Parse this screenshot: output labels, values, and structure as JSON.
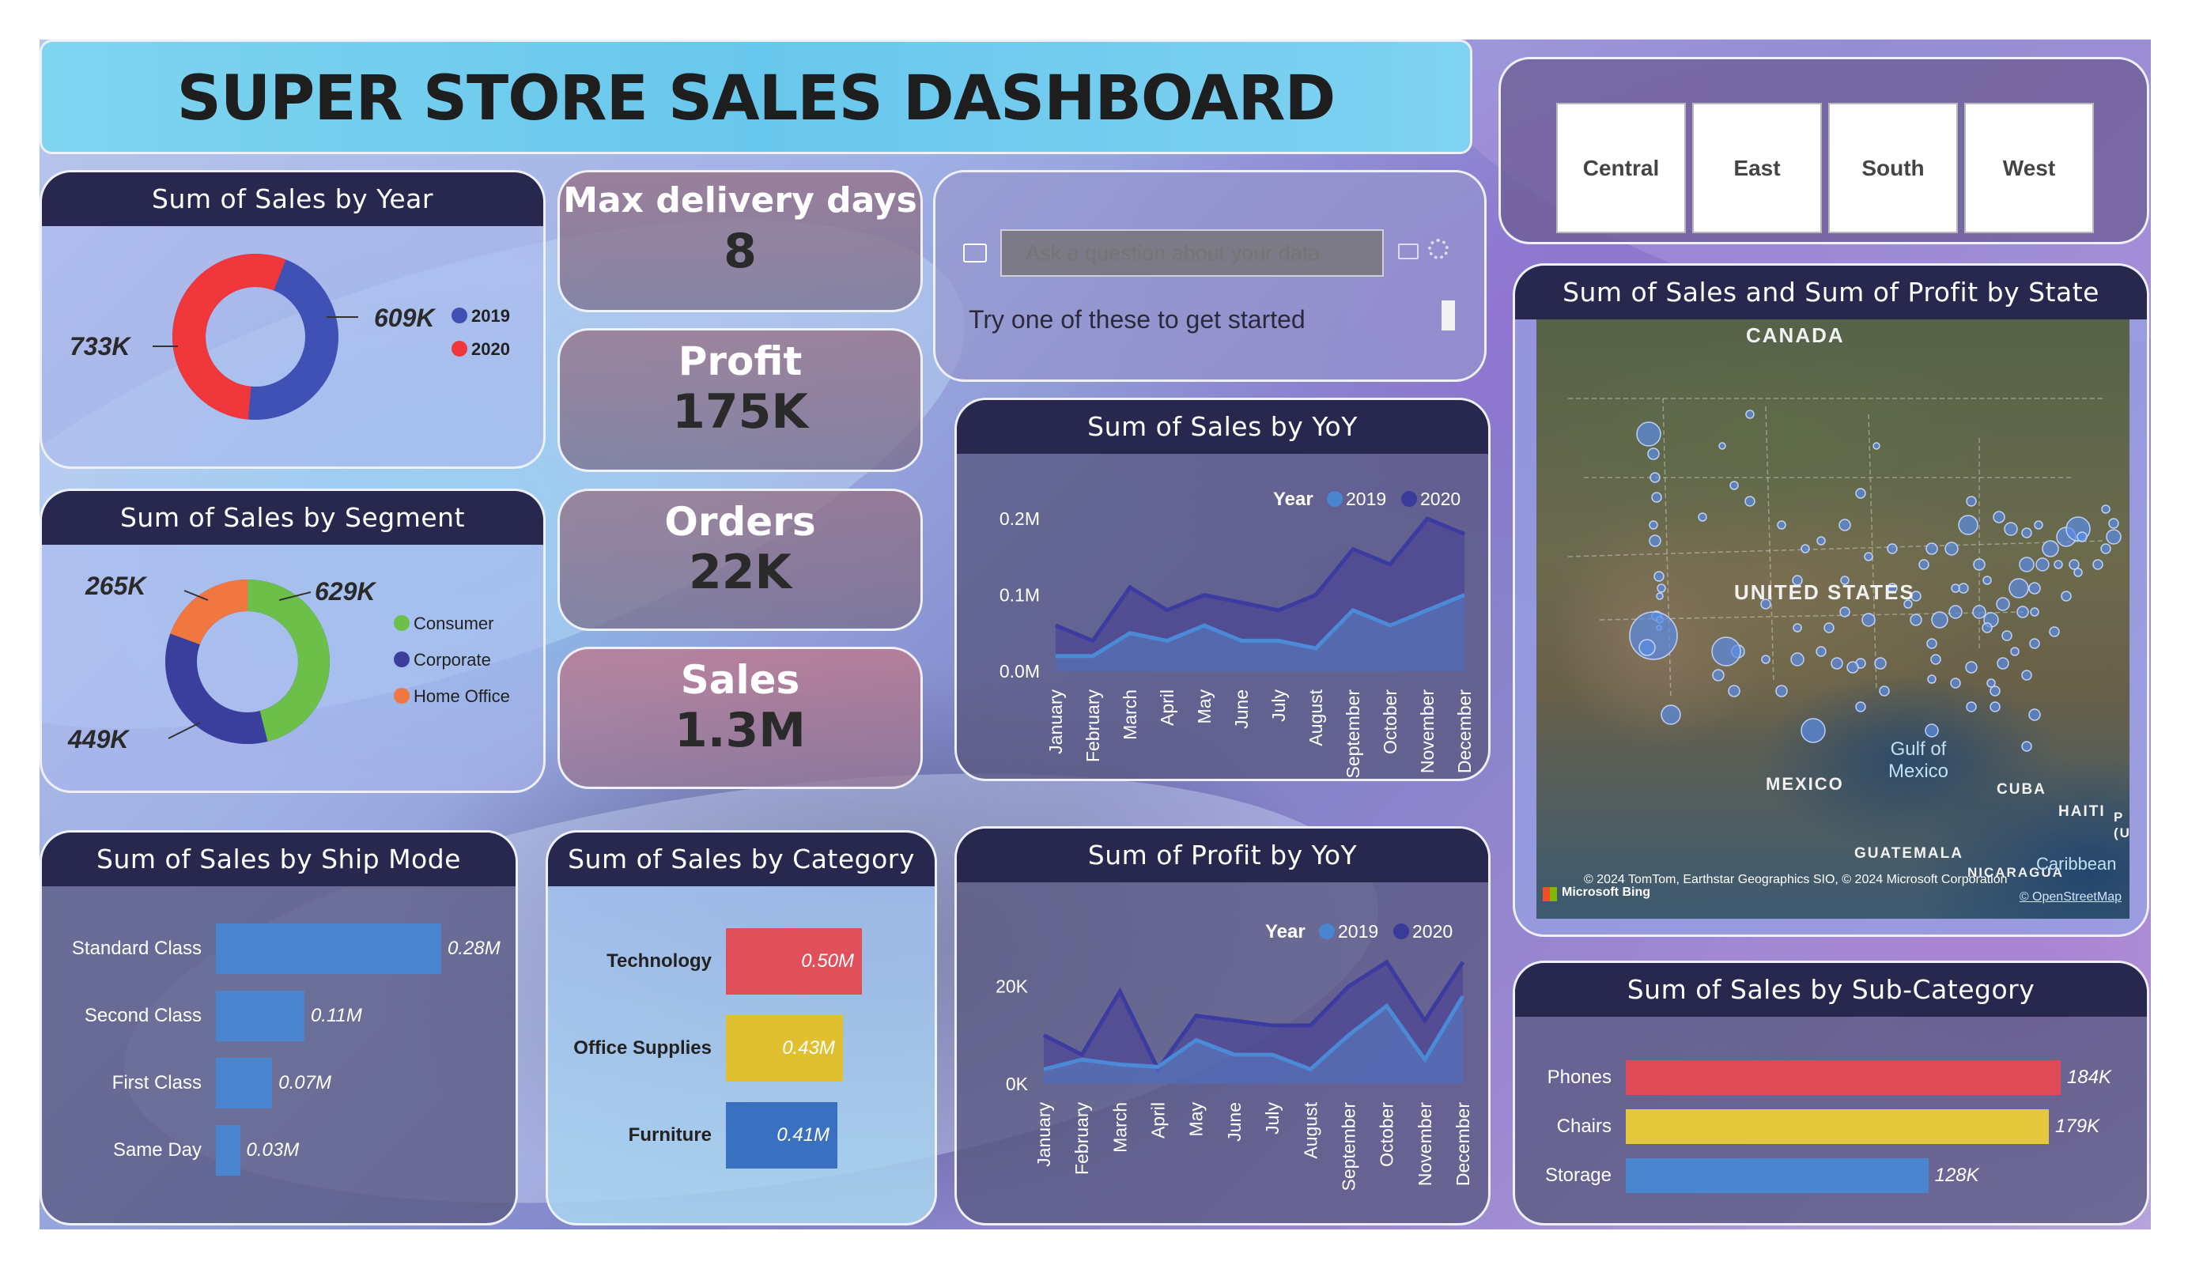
{
  "title": "SUPER STORE SALES DASHBOARD",
  "regions": [
    "Central",
    "East",
    "South",
    "West"
  ],
  "kpis": {
    "max_delivery": {
      "label": "Max delivery days",
      "value": "8"
    },
    "profit": {
      "label": "Profit",
      "value": "175K"
    },
    "orders": {
      "label": "Orders",
      "value": "22K"
    },
    "sales": {
      "label": "Sales",
      "value": "1.3M"
    }
  },
  "qa": {
    "placeholder": "Ask a question about your data",
    "hint": "Try one of these to get started"
  },
  "sales_by_year": {
    "title": "Sum of Sales by Year",
    "labels": [
      "733K",
      "609K"
    ],
    "legend": [
      "2019",
      "2020"
    ],
    "colors": [
      "#3f51b5",
      "#f0373b"
    ]
  },
  "sales_by_segment": {
    "title": "Sum of Sales by Segment",
    "labels": [
      "629K",
      "449K",
      "265K"
    ],
    "legend": [
      "Consumer",
      "Corporate",
      "Home Office"
    ],
    "colors": [
      "#6cc04a",
      "#3a3f9e",
      "#f07840"
    ]
  },
  "yoy": {
    "legend_title": "Year",
    "legend": [
      "2019",
      "2020"
    ],
    "months": [
      "January",
      "February",
      "March",
      "April",
      "May",
      "June",
      "July",
      "August",
      "September",
      "October",
      "November",
      "December"
    ]
  },
  "map": {
    "title": "Sum of Sales and Sum of Profit by State",
    "labels": {
      "canada": "CANADA",
      "us": "UNITED STATES",
      "mexico": "MEXICO",
      "gulf": "Gulf of Mexico",
      "cuba": "CUBA",
      "haiti": "HAITI",
      "guatemala": "GUATEMALA",
      "nicaragua": "NICARAGUA",
      "caribbean": "Caribbean",
      "edge": "P (U"
    },
    "bing": "Microsoft Bing",
    "copyright": "© 2024 TomTom, Earthstar Geographics SIO, © 2024 Microsoft Corporation",
    "osm": "© OpenStreetMap"
  },
  "chart_data": [
    {
      "type": "pie",
      "title": "Sum of Sales by Year",
      "categories": [
        "2019",
        "2020"
      ],
      "values": [
        609,
        733
      ],
      "unit": "K"
    },
    {
      "type": "pie",
      "title": "Sum of Sales by Segment",
      "categories": [
        "Consumer",
        "Corporate",
        "Home Office"
      ],
      "values": [
        629,
        449,
        265
      ],
      "unit": "K"
    },
    {
      "type": "area",
      "title": "Sum of Sales by YoY",
      "x": [
        "January",
        "February",
        "March",
        "April",
        "May",
        "June",
        "July",
        "August",
        "September",
        "October",
        "November",
        "December"
      ],
      "ylim": [
        0,
        0.2
      ],
      "yticks": [
        "0.0M",
        "0.1M",
        "0.2M"
      ],
      "series": [
        {
          "name": "2019",
          "values": [
            0.02,
            0.02,
            0.05,
            0.04,
            0.06,
            0.04,
            0.04,
            0.03,
            0.08,
            0.06,
            0.08,
            0.1
          ]
        },
        {
          "name": "2020",
          "values": [
            0.06,
            0.04,
            0.11,
            0.08,
            0.1,
            0.09,
            0.08,
            0.1,
            0.16,
            0.14,
            0.2,
            0.18
          ]
        }
      ]
    },
    {
      "type": "area",
      "title": "Sum of Profit by YoY",
      "x": [
        "January",
        "February",
        "March",
        "April",
        "May",
        "June",
        "July",
        "August",
        "September",
        "October",
        "November",
        "December"
      ],
      "ylim": [
        0,
        30000
      ],
      "yticks": [
        "0K",
        "20K"
      ],
      "series": [
        {
          "name": "2019",
          "values": [
            3000,
            5000,
            4000,
            3500,
            9000,
            6000,
            6000,
            3000,
            10000,
            16000,
            5000,
            18000
          ]
        },
        {
          "name": "2020",
          "values": [
            10000,
            6000,
            19000,
            3000,
            14000,
            13000,
            12000,
            12000,
            20000,
            25000,
            13000,
            25000
          ]
        }
      ]
    },
    {
      "type": "bar",
      "title": "Sum of Sales by Ship Mode",
      "categories": [
        "Standard Class",
        "Second Class",
        "First Class",
        "Same Day"
      ],
      "values": [
        0.28,
        0.11,
        0.07,
        0.03
      ],
      "value_labels": [
        "0.28M",
        "0.11M",
        "0.07M",
        "0.03M"
      ]
    },
    {
      "type": "bar",
      "title": "Sum of Sales by Category",
      "categories": [
        "Technology",
        "Office Supplies",
        "Furniture"
      ],
      "values": [
        0.5,
        0.43,
        0.41
      ],
      "value_labels": [
        "0.50M",
        "0.43M",
        "0.41M"
      ],
      "colors": [
        "#e0505a",
        "#e0c030",
        "#3a70c0"
      ]
    },
    {
      "type": "bar",
      "title": "Sum of Sales by Sub-Category",
      "categories": [
        "Phones",
        "Chairs",
        "Storage"
      ],
      "values": [
        184,
        179,
        128
      ],
      "value_labels": [
        "184K",
        "179K",
        "128K"
      ],
      "colors": [
        "#e04a55",
        "#e2c83a",
        "#4a86d0"
      ]
    }
  ],
  "titles": {
    "yoy_sales": "Sum of Sales by YoY",
    "yoy_profit": "Sum of Profit by YoY",
    "ship_mode": "Sum of Sales by Ship Mode",
    "category": "Sum of Sales by Category",
    "subcategory": "Sum of Sales by Sub-Category"
  }
}
